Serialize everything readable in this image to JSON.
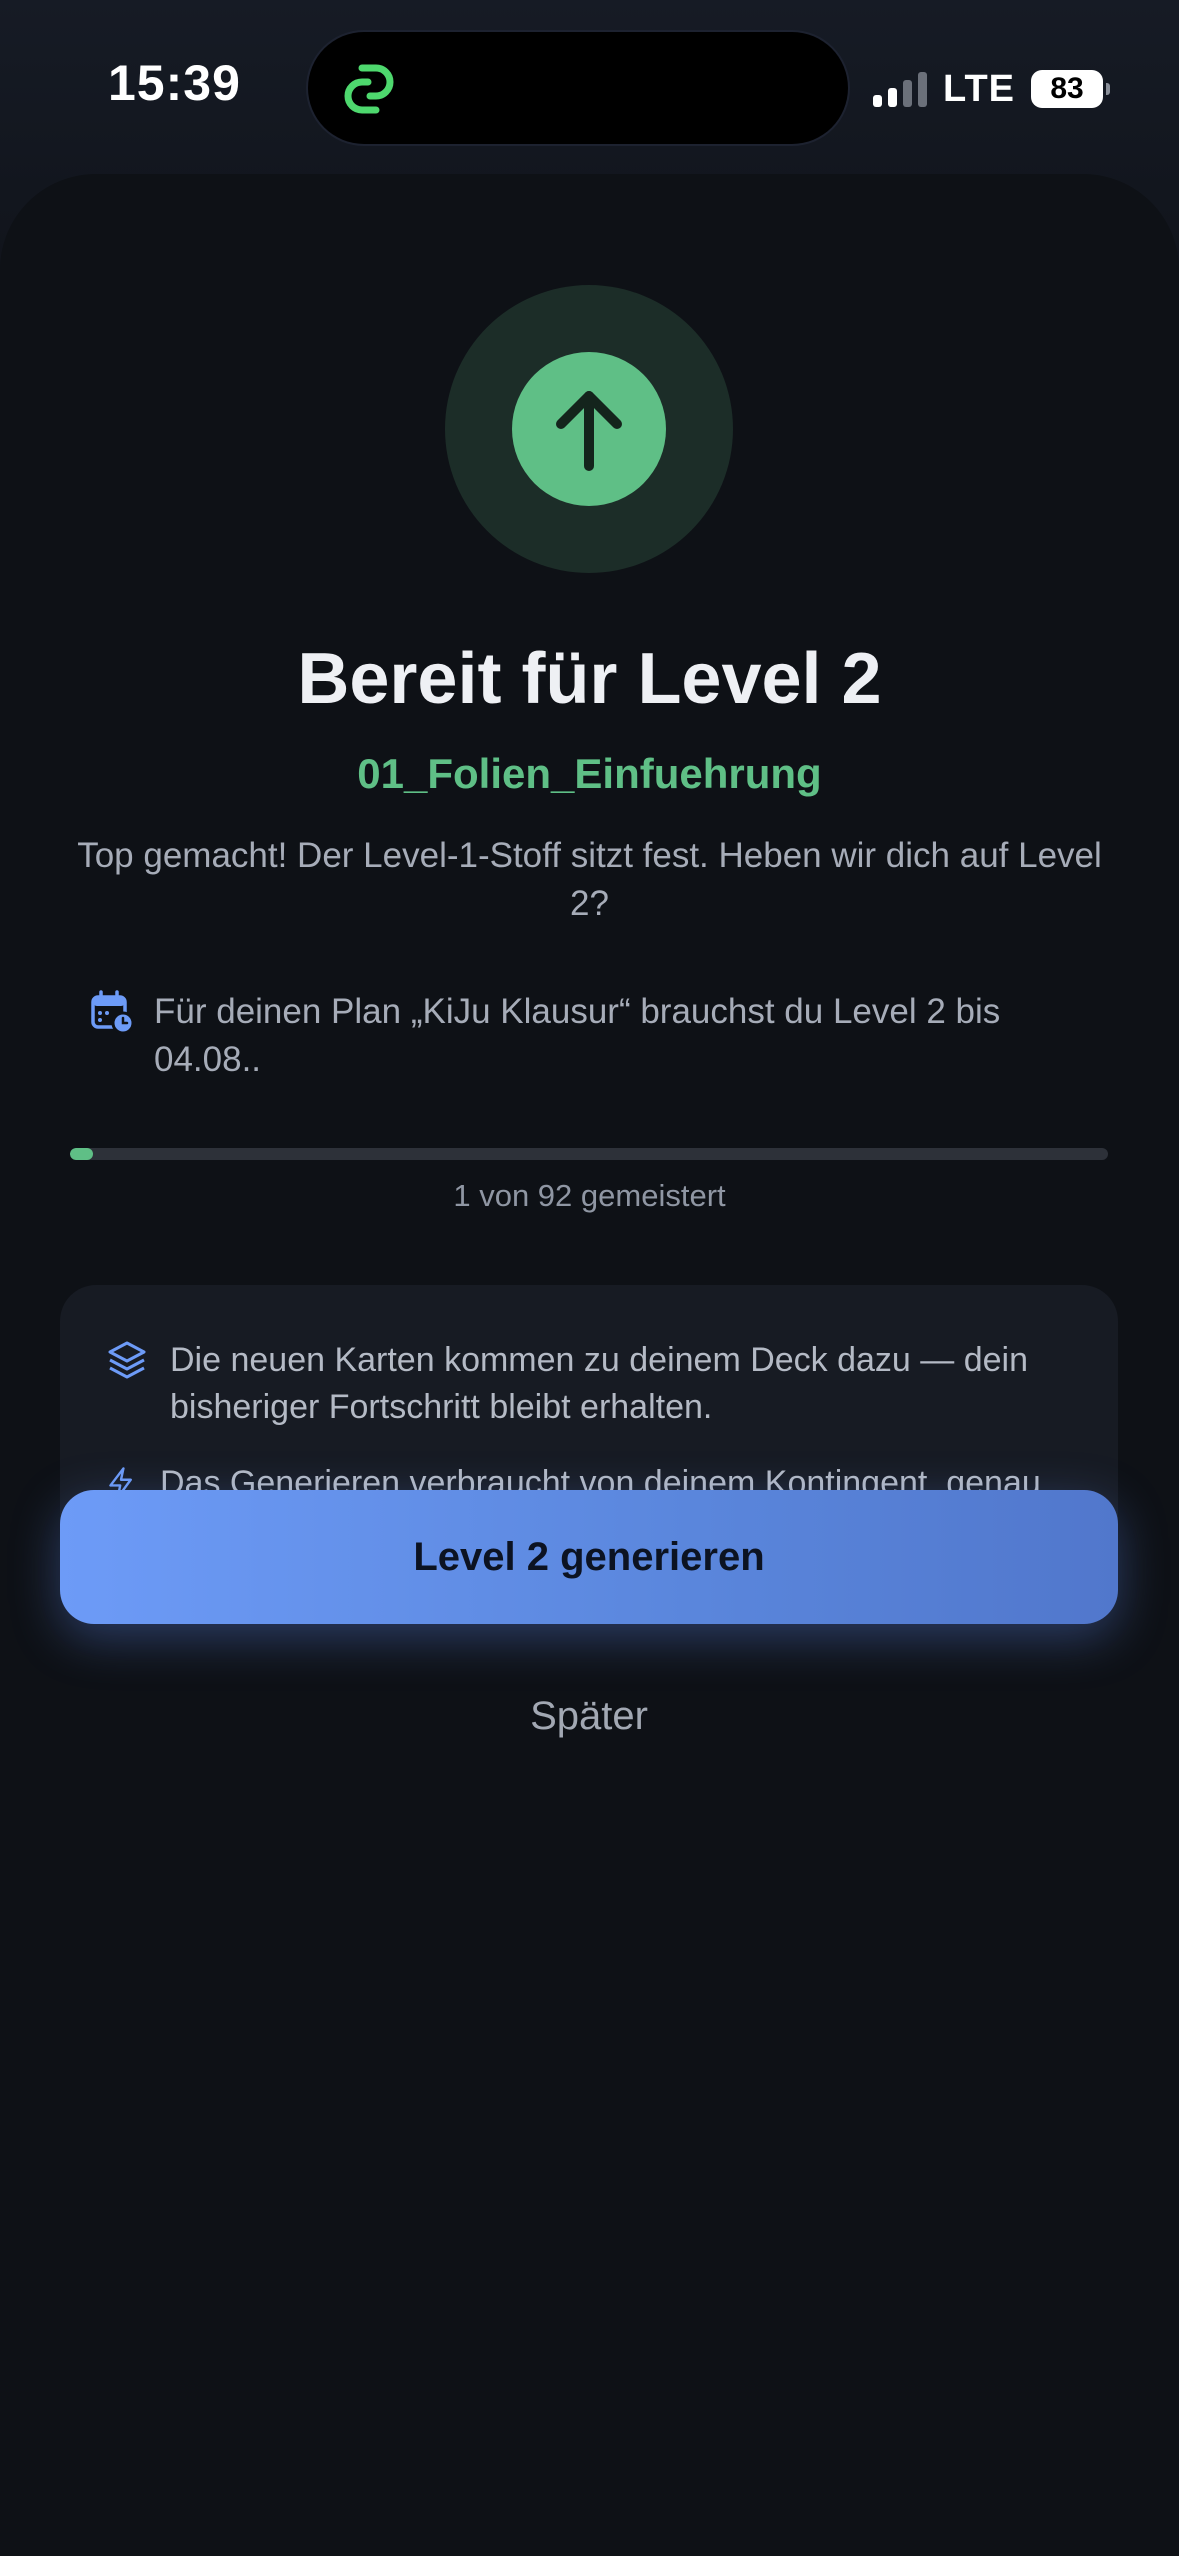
{
  "status_bar": {
    "time": "15:39",
    "network": "LTE",
    "battery": "83",
    "signal_bars_active": 2,
    "signal_bars_total": 4
  },
  "hero": {
    "icon": "arrow-up-icon",
    "title": "Bereit für Level 2",
    "deck_name": "01_Folien_Einfuehrung",
    "description": "Top gemacht! Der Level-1-Stoff sitzt fest. Heben wir dich auf Level 2?"
  },
  "plan_note": {
    "icon": "calendar-clock-icon",
    "text": "Für deinen Plan „KiJu Klausur“ brauchst du Level 2 bis 04.08.."
  },
  "progress": {
    "mastered": 1,
    "total": 92,
    "label": "1 von 92 gemeistert"
  },
  "info": {
    "items": [
      {
        "icon": "layers-icon",
        "text": "Die neuen Karten kommen zu deinem Deck dazu — dein bisheriger Fortschritt bleibt erhalten."
      },
      {
        "icon": "lightning-icon",
        "text": "Das Generieren verbraucht von deinem Kontingent, genau wie beim ersten Import."
      }
    ]
  },
  "actions": {
    "primary_label": "Level 2 generieren",
    "secondary_label": "Später"
  },
  "colors": {
    "accent_green": "#5fbf86",
    "accent_blue": "#6d9bf7",
    "background": "#0e1116"
  }
}
